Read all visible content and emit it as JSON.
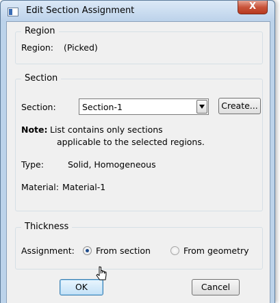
{
  "window": {
    "title": "Edit Section Assignment",
    "close_label": "X"
  },
  "region": {
    "group_title": "Region",
    "label": "Region:",
    "value": "(Picked)"
  },
  "section": {
    "group_title": "Section",
    "label": "Section:",
    "selected": "Section-1",
    "create_label": "Create...",
    "note_label": "Note:",
    "note_line1": "List contains only sections",
    "note_line2": "applicable to the selected regions.",
    "type_label": "Type:",
    "type_value": "Solid, Homogeneous",
    "material_label": "Material:",
    "material_value": "Material-1"
  },
  "thickness": {
    "group_title": "Thickness",
    "assignment_label": "Assignment:",
    "options": [
      {
        "label": "From section",
        "checked": true
      },
      {
        "label": "From geometry",
        "checked": false
      }
    ]
  },
  "buttons": {
    "ok": "OK",
    "cancel": "Cancel"
  }
}
